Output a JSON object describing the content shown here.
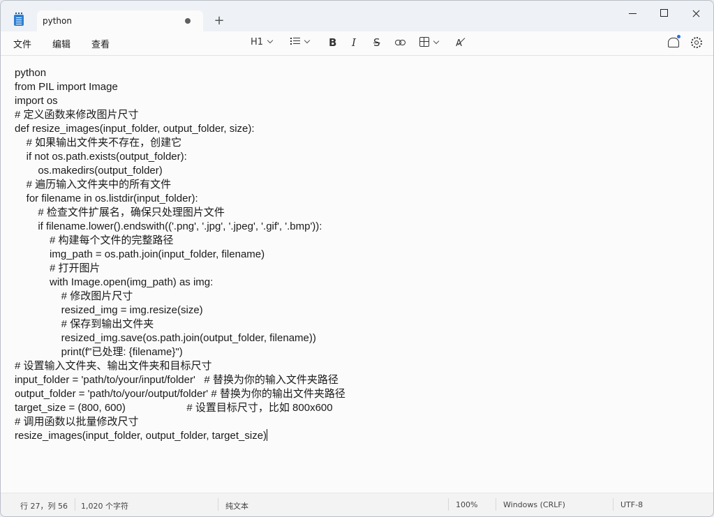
{
  "tab": {
    "title": "python"
  },
  "menu": {
    "file": "文件",
    "edit": "编辑",
    "view": "查看"
  },
  "toolbar": {
    "heading": "H1"
  },
  "editor": {
    "lines": [
      "python",
      "from PIL import Image",
      "import os",
      "# 定义函数来修改图片尺寸",
      "def resize_images(input_folder, output_folder, size):",
      "    # 如果输出文件夹不存在，创建它",
      "    if not os.path.exists(output_folder):",
      "        os.makedirs(output_folder)",
      "    # 遍历输入文件夹中的所有文件",
      "    for filename in os.listdir(input_folder):",
      "        # 检查文件扩展名，确保只处理图片文件",
      "        if filename.lower().endswith(('.png', '.jpg', '.jpeg', '.gif', '.bmp')):",
      "            # 构建每个文件的完整路径",
      "            img_path = os.path.join(input_folder, filename)",
      "            # 打开图片",
      "            with Image.open(img_path) as img:",
      "                # 修改图片尺寸",
      "                resized_img = img.resize(size)",
      "                # 保存到输出文件夹",
      "                resized_img.save(os.path.join(output_folder, filename))",
      "                print(f\"已处理: {filename}\")",
      "# 设置输入文件夹、输出文件夹和目标尺寸",
      "input_folder = 'path/to/your/input/folder'   # 替换为你的输入文件夹路径",
      "output_folder = 'path/to/your/output/folder' # 替换为你的输出文件夹路径",
      "target_size = (800, 600)                     # 设置目标尺寸，比如 800x600",
      "# 调用函数以批量修改尺寸",
      "resize_images(input_folder, output_folder, target_size)"
    ]
  },
  "status": {
    "position": "行 27，列 56",
    "chars": "1,020 个字符",
    "format": "纯文本",
    "zoom": "100%",
    "line_ending": "Windows (CRLF)",
    "encoding": "UTF-8"
  }
}
